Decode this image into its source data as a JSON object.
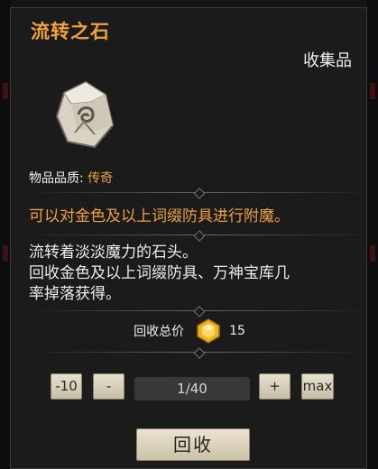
{
  "item": {
    "name": "流转之石",
    "category": "收集品",
    "icon": "stone-rune-icon",
    "quality_label": "物品品质:",
    "quality_value": "传奇",
    "effect": "可以对金色及以上词缀防具进行附魔。",
    "description": "流转着淡淡魔力的石头。\n回收金色及以上词缀防具、万神宝库几率掉落获得。"
  },
  "recycle": {
    "total_label": "回收总价",
    "currency_icon": "gold-gem-icon",
    "total_value": "15",
    "minus10_label": "-10",
    "minus_label": "-",
    "quantity": "1/40",
    "plus_label": "+",
    "max_label": "max",
    "button_label": "回收"
  },
  "colors": {
    "accent": "#f0a13a",
    "panel_bg": "#1c1b1c",
    "button_bg": "#e2dac6"
  }
}
